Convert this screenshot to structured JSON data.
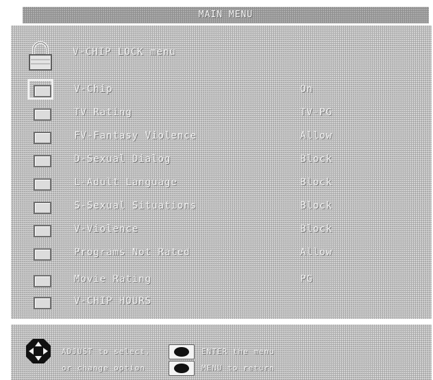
{
  "window": {
    "title": "MAIN MENU"
  },
  "header": {
    "label": "V-CHIP LOCK menu",
    "icon": "lock-icon"
  },
  "items": [
    {
      "label": "V-Chip",
      "value": "On",
      "selected": true
    },
    {
      "label": "TV Rating",
      "value": "TV-PG"
    },
    {
      "label": "FV-Fantasy Violence",
      "value": "Allow"
    },
    {
      "label": "D-Sexual Dialog",
      "value": "Block"
    },
    {
      "label": "L-Adult Language",
      "value": "Block"
    },
    {
      "label": "S-Sexual Situations",
      "value": "Block"
    },
    {
      "label": "V-Violence",
      "value": "Block"
    },
    {
      "label": "Programs Not Rated",
      "value": "Allow"
    },
    {
      "label": "Movie Rating",
      "value": "PG"
    },
    {
      "label": "V-CHIP HOURS",
      "value": ""
    }
  ],
  "footer": {
    "nav_text_1": "ADJUST to select,",
    "nav_text_2": "or change option",
    "enter_text": "ENTER the menu",
    "menu_text": "MENU to return",
    "icons": [
      "dpad-icon",
      "enter-button-icon",
      "menu-button-icon"
    ]
  },
  "colors": {
    "panel": "#b9b9b9",
    "title_bar": "#8f8f8f",
    "text": "#f2f2f2"
  }
}
